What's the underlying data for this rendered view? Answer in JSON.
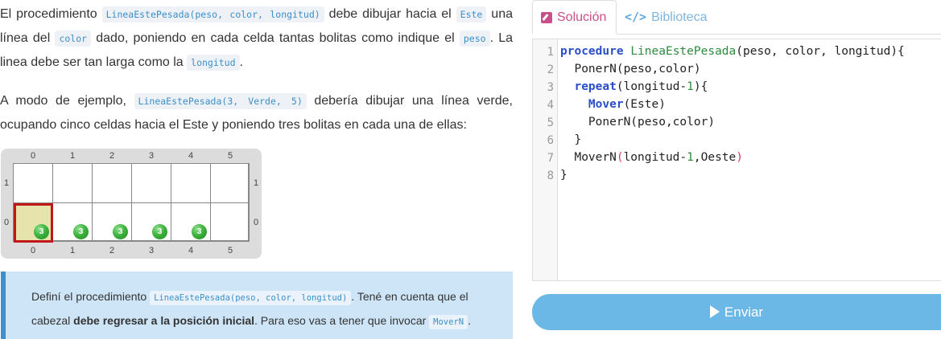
{
  "description": {
    "p1": {
      "t1": "El procedimiento ",
      "c1": "LineaEstePesada(peso, color, longitud)",
      "t2": " debe dibujar hacia el ",
      "c2": "Este",
      "t3": " una línea del ",
      "c3": "color",
      "t4": " dado, poniendo en cada celda tantas bolitas como indique el ",
      "c4": "peso",
      "t5": ". La linea debe ser tan larga como la ",
      "c5": "longitud",
      "t6": "."
    },
    "p2": {
      "t1": "A modo de ejemplo, ",
      "c1": "LineaEstePesada(3, Verde, 5)",
      "t2": " debería dibujar una línea verde, ocupando cinco celdas hacia el Este y poniendo tres bolitas en cada una de ellas:"
    }
  },
  "board": {
    "columns": [
      "0",
      "1",
      "2",
      "3",
      "4",
      "5"
    ],
    "rows": [
      "1",
      "0"
    ],
    "balls": [
      {
        "count": "3",
        "color": "#3fb33f"
      },
      {
        "count": "3",
        "color": "#3fb33f"
      },
      {
        "count": "3",
        "color": "#3fb33f"
      },
      {
        "count": "3",
        "color": "#3fb33f"
      },
      {
        "count": "3",
        "color": "#3fb33f"
      }
    ],
    "head_color": "#c01818"
  },
  "note": {
    "t1": "Definí el procedimiento ",
    "c1": "LineaEstePesada(peso, color, longitud)",
    "t2": ". Tené en cuenta que el cabezal ",
    "b1": "debe regresar a la posición inicial",
    "t3": ". Para eso vas a tener que invocar ",
    "c2": "MoverN",
    "t4": "."
  },
  "tabs": {
    "solution": "Solución",
    "library_icon": "</>",
    "library": "Biblioteca"
  },
  "editor": {
    "line_numbers": [
      "1",
      "2",
      "3",
      "4",
      "5",
      "6",
      "7",
      "8"
    ],
    "lines": [
      {
        "kw": "procedure",
        "sp": " ",
        "fn": "LineaEstePesada",
        "rest": "(peso, color, longitud){"
      },
      {
        "pre": "  PonerN(peso,color)"
      },
      {
        "pre": "  ",
        "kw": "repeat",
        "a": "(longitud-",
        "num": "1",
        "b": "){"
      },
      {
        "pre": "    ",
        "kw": "Mover",
        "a": "(Este)"
      },
      {
        "pre": "    PonerN(peso,color)"
      },
      {
        "pre": "  }"
      },
      {
        "pre": "  MoverN",
        "p1": "(",
        "a": "longitud-",
        "num": "1",
        "b": ",Oeste",
        "p2": ")"
      },
      {
        "pre": "}"
      }
    ]
  },
  "submit": {
    "label": "Enviar"
  },
  "colors": {
    "accent": "#c94f8a",
    "link": "#7fb4de",
    "button": "#6bb7e6",
    "note_bg": "#cde5f6"
  }
}
